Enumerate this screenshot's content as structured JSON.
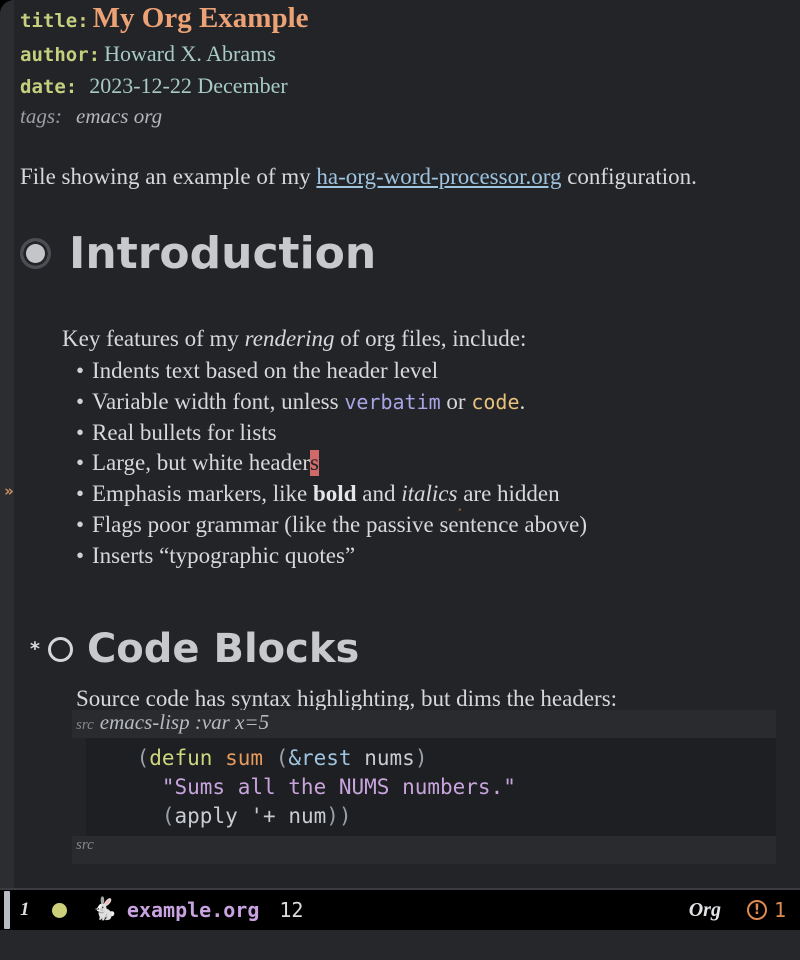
{
  "document": {
    "keywords": [
      {
        "label": "title:",
        "value": "My Org Example"
      },
      {
        "label": "author:",
        "value": "Howard X. Abrams"
      },
      {
        "label": "date:",
        "value": "2023-12-22 December"
      },
      {
        "label": "tags:",
        "value": "emacs org"
      }
    ],
    "intro": {
      "before_link": "File showing an example of my ",
      "link_text": "ha-org-word-processor.org",
      "after_link": " configuration."
    },
    "sections": [
      {
        "level": 1,
        "heading": "Introduction",
        "lead": "Key features of my rendering of org files, include:",
        "lead_parts": {
          "a": "Key features of my ",
          "italic": "rendering",
          "b": " of org files, include:"
        },
        "bullets": [
          {
            "text": "Indents text based on the header level"
          },
          {
            "parts": {
              "a": "Variable width font, unless ",
              "verbatim": "verbatim",
              "b": " or ",
              "code": "code",
              "c": "."
            }
          },
          {
            "text": "Real bullets for lists"
          },
          {
            "parts": {
              "a": "Large, but white header",
              "cursor": "s"
            }
          },
          {
            "parts": {
              "a": "Emphasis markers, like ",
              "bold": "bold",
              "b": " and ",
              "italic": "italics",
              "c": " are hidden"
            }
          },
          {
            "text": "Flags poor grammar (like the passive sentence above)"
          },
          {
            "text": "Inserts “typographic quotes”"
          }
        ]
      },
      {
        "level": 2,
        "heading": "Code Blocks",
        "heading_star": "*",
        "lead": "Source code has syntax highlighting, but dims the headers:",
        "src_block": {
          "begin_keyword": "src",
          "args": "emacs-lisp :var x=5",
          "end_keyword": "src",
          "language": "emacs-lisp",
          "lines": [
            {
              "tokens": [
                {
                  "t": "(",
                  "c": "paren"
                },
                {
                  "t": "defun",
                  "c": "defun"
                },
                {
                  "t": " ",
                  "c": "plain"
                },
                {
                  "t": "sum",
                  "c": "fname"
                },
                {
                  "t": " ",
                  "c": "plain"
                },
                {
                  "t": "(",
                  "c": "paren"
                },
                {
                  "t": "&rest",
                  "c": "amp"
                },
                {
                  "t": " ",
                  "c": "plain"
                },
                {
                  "t": "nums",
                  "c": "arg"
                },
                {
                  "t": ")",
                  "c": "paren"
                }
              ],
              "indent": 2
            },
            {
              "tokens": [
                {
                  "t": "\"Sums all the NUMS numbers.\"",
                  "c": "string"
                }
              ],
              "indent": 3
            },
            {
              "tokens": [
                {
                  "t": "(",
                  "c": "paren"
                },
                {
                  "t": "apply",
                  "c": "sym"
                },
                {
                  "t": " ",
                  "c": "plain"
                },
                {
                  "t": "'+",
                  "c": "sym"
                },
                {
                  "t": " ",
                  "c": "plain"
                },
                {
                  "t": "num",
                  "c": "sym"
                },
                {
                  "t": "))",
                  "c": "paren"
                }
              ],
              "indent": 3
            }
          ]
        }
      }
    ]
  },
  "modeline": {
    "window_number": "1",
    "status_dot": "●",
    "gnu_icon": "gnu-icon",
    "buffer_name": "example.org",
    "position": "12",
    "major_mode": "Org",
    "error_icon": "!",
    "error_count": "1"
  },
  "fringe": {
    "continuation_marker": "»"
  },
  "colors": {
    "background": "#232428",
    "fringe": "#2b2d31",
    "title_accent": "#eda276",
    "keyword_label": "#c5cf7d",
    "metadata_value": "#a7cbc4",
    "link": "#9fc4e0",
    "heading": "#c7c9cc",
    "cursor": "#cf6a6a",
    "verbatim": "#a8a4e6",
    "code_face": "#e8c07d",
    "src_background": "#1e1f22",
    "modeline_background": "#000000",
    "buffer_name": "#c9a2e0",
    "error_accent": "#e08a4e"
  }
}
